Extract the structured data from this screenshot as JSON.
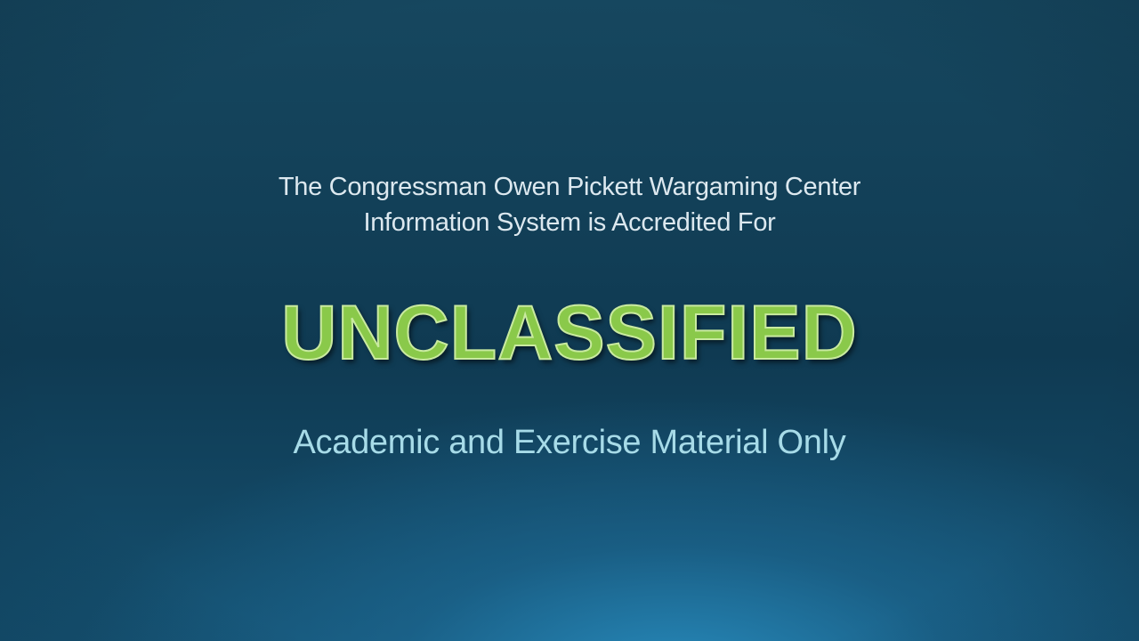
{
  "slide": {
    "intro_line_1": "The Congressman Owen Pickett Wargaming Center",
    "intro_line_2": "Information System is Accredited For",
    "classification": "UNCLASSIFIED",
    "subtitle": "Academic and Exercise Material Only"
  },
  "colors": {
    "background_dark": "#0f3a52",
    "background_glow": "#2a8cbe",
    "intro_text": "#dce8ef",
    "classification_fill": "#8ac94a",
    "classification_outline": "#c9eaa0",
    "subtitle_text": "#a7dbe8"
  }
}
